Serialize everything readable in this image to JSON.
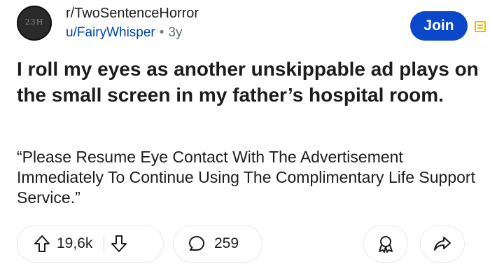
{
  "post": {
    "subreddit": "r/TwoSentenceHorror",
    "author": "u/FairyWhisper",
    "separator": "•",
    "age": "3y",
    "avatar_text": "23H",
    "join_label": "Join",
    "title": "I roll my eyes as another unskippable ad plays on the small screen in my father’s hospital room.",
    "body": "“Please Resume Eye Contact With The Advertisement Immediately To Continue Using The Complimentary Life Support Service.”"
  },
  "actions": {
    "upvotes": "19,6k",
    "comments": "259"
  },
  "colors": {
    "join_button": "#0a47c9",
    "menu_icon": "#f5b800",
    "username": "#0045ac"
  },
  "icons": [
    "avatar",
    "menu-icon",
    "upvote-icon",
    "downvote-icon",
    "comment-icon",
    "award-icon",
    "share-icon"
  ]
}
